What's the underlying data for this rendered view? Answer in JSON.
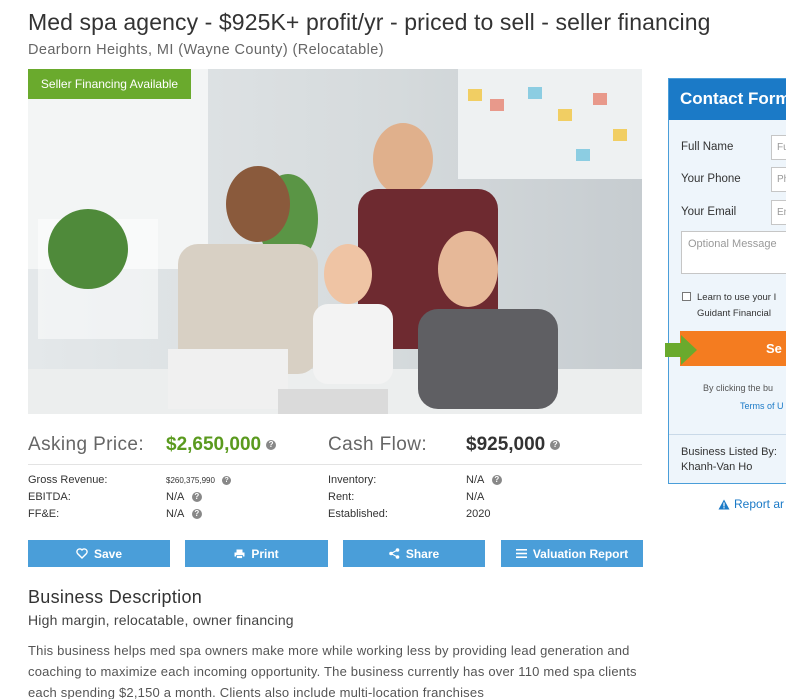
{
  "listing": {
    "title": "Med spa agency - $925K+ profit/yr - priced to sell - seller financing",
    "location": "Dearborn Heights, MI (Wayne County) (Relocatable)",
    "badge": "Seller Financing Available"
  },
  "financials": {
    "asking_price_label": "Asking Price:",
    "asking_price": "$2,650,000",
    "cash_flow_label": "Cash Flow:",
    "cash_flow": "$925,000",
    "gross_revenue_label": "Gross Revenue:",
    "gross_revenue": "$260,375,990",
    "ebitda_label": "EBITDA:",
    "ebitda": "N/A",
    "ffe_label": "FF&E:",
    "ffe": "N/A",
    "inventory_label": "Inventory:",
    "inventory": "N/A",
    "rent_label": "Rent:",
    "rent": "N/A",
    "established_label": "Established:",
    "established": "2020"
  },
  "actions": {
    "save": "Save",
    "print": "Print",
    "share": "Share",
    "valuation": "Valuation Report"
  },
  "description": {
    "heading": "Business Description",
    "subheading": "High margin, relocatable, owner financing",
    "body": "This business helps med spa owners make more while working less by providing lead generation and coaching to maximize each incoming opportunity. The business currently has over 110 med spa clients each spending $2,150 a month. Clients also include multi-location franchises"
  },
  "contact": {
    "heading": "Contact Form",
    "full_name_label": "Full Name",
    "full_name_placeholder": "Fu",
    "phone_label": "Your Phone",
    "phone_placeholder": "Ph",
    "email_label": "Your Email",
    "email_placeholder": "En",
    "message_placeholder": "Optional Message",
    "learn_line1": "Learn to use your I",
    "learn_line2": "Guidant Financial",
    "send": "Se",
    "by_clicking": "By clicking the bu",
    "terms": "Terms of U",
    "listed_by_label": "Business Listed By:",
    "listed_by_name": "Khanh-Van Ho"
  },
  "report": {
    "label": "Report ar"
  },
  "colors": {
    "accent_blue": "#4a9ed9",
    "header_blue": "#1b7ac7",
    "price_green": "#5a9a1e",
    "badge_green": "#6aaa2d",
    "send_orange": "#f47c20"
  },
  "icons": {
    "save": "heart-icon",
    "print": "printer-icon",
    "share": "share-icon",
    "valuation": "list-icon",
    "info": "info-icon",
    "report": "warning-icon",
    "arrow": "green-arrow-icon"
  }
}
